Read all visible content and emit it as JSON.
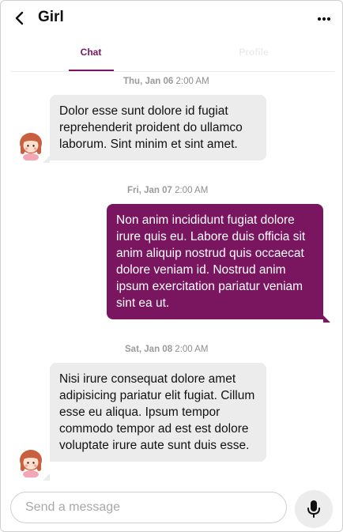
{
  "header": {
    "title": "Girl"
  },
  "tabs": [
    {
      "label": "Chat",
      "active": true
    },
    {
      "label": "Profile",
      "active": false
    }
  ],
  "messages": [
    {
      "day": "Thu, Jan 06",
      "time": "2:00 AM",
      "direction": "incoming",
      "text": "Dolor esse sunt dolore id fugiat reprehenderit proident do ullamco laborum. Sint minim et sint amet."
    },
    {
      "day": "Fri, Jan 07",
      "time": "2:00 AM",
      "direction": "outgoing",
      "text": "Non anim incididunt fugiat dolore irure quis eu. Labore duis officia sit anim aliquip nostrud quis occaecat dolore veniam id. Nostrud anim ipsum exercitation pariatur veniam sint ea ut."
    },
    {
      "day": "Sat, Jan 08",
      "time": "2:00 AM",
      "direction": "incoming",
      "text": "Nisi irure consequat dolore amet adipisicing pariatur elit fugiat. Cillum esse eu aliqua. Ipsum tempor commodo tempor ad est est dolore voluptate irure aute sunt duis esse."
    }
  ],
  "composer": {
    "placeholder": "Send a message"
  },
  "icons": {
    "back": "chevron-left-icon",
    "more": "more-horizontal-icon",
    "mic": "microphone-icon",
    "avatar": "girl-avatar-icon"
  },
  "colors": {
    "accent": "#7a1560",
    "incoming_bubble": "#ececec",
    "outgoing_text": "#ffffff"
  }
}
